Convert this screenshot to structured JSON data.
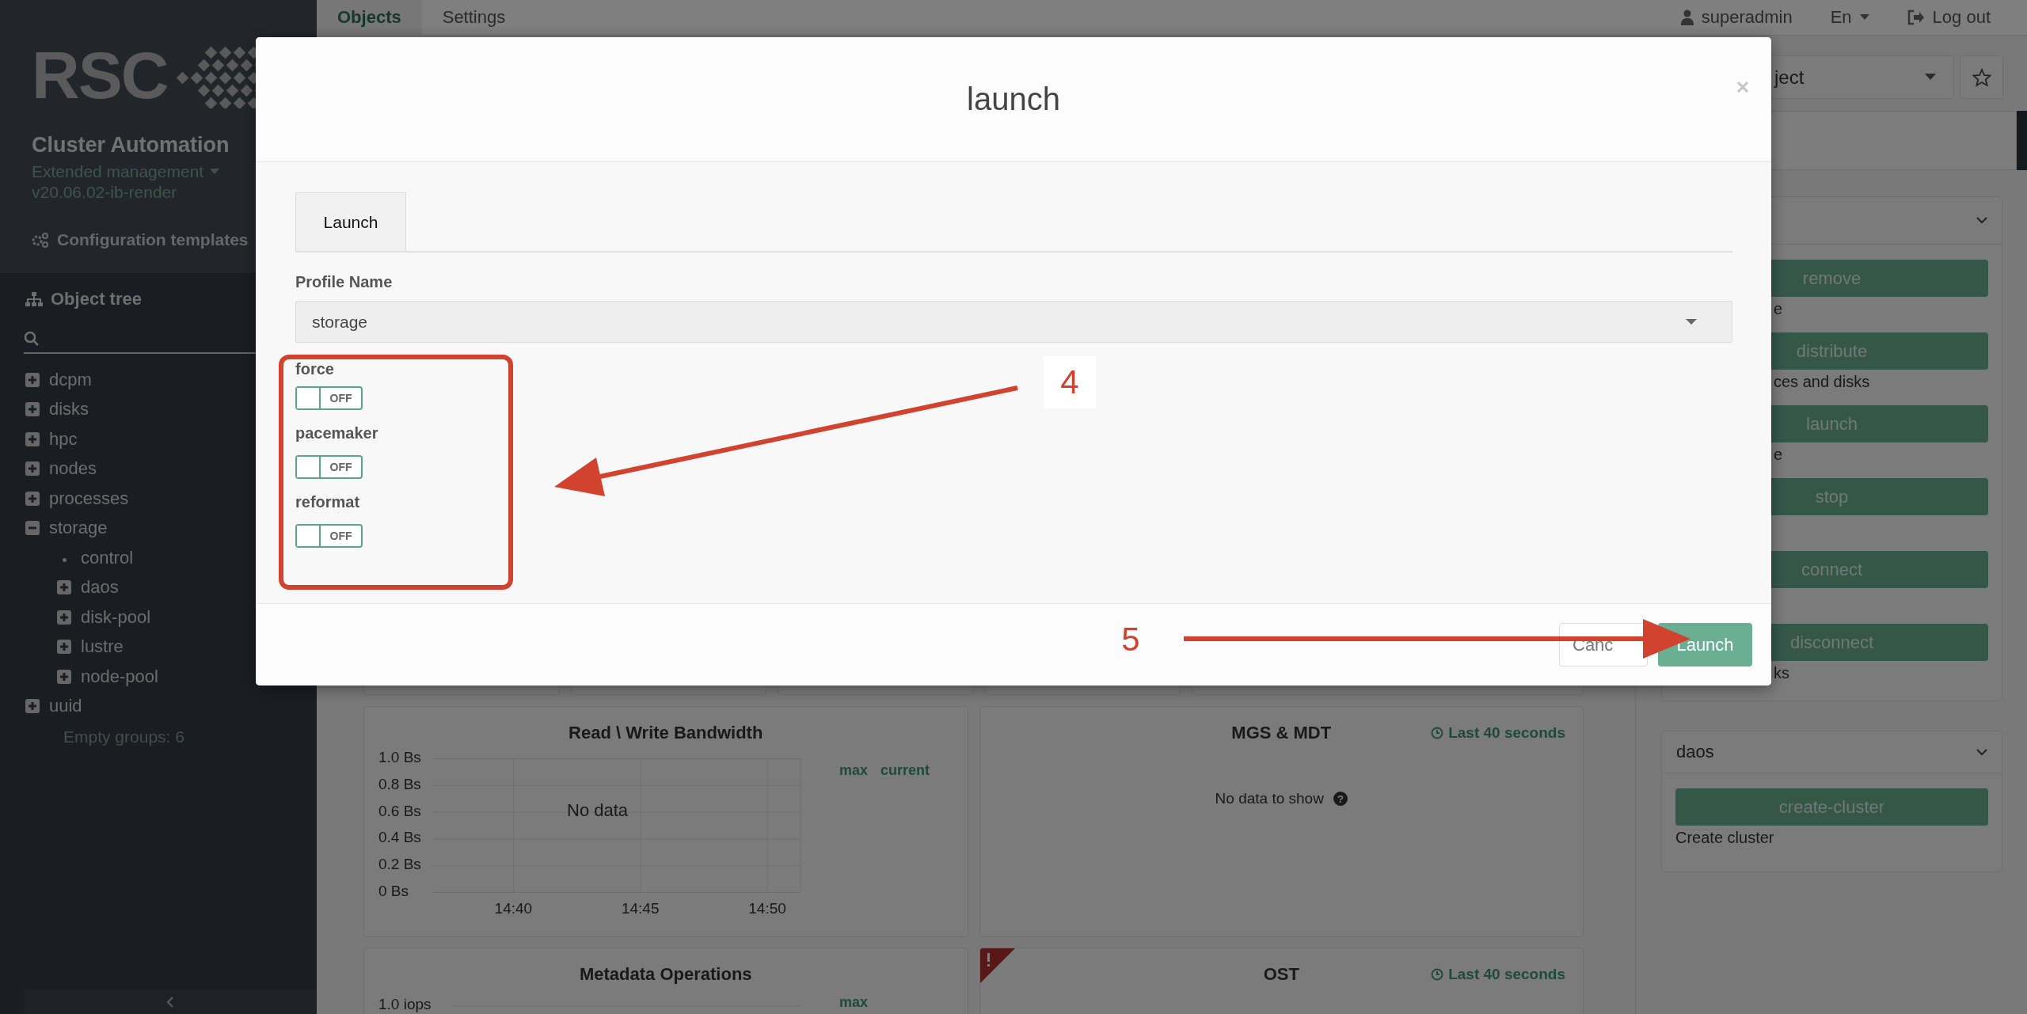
{
  "sidebar": {
    "logo": "RSC",
    "app_title": "Cluster Automation",
    "edition": "Extended management",
    "version": "v20.06.02-ib-render",
    "config_link": "Configuration templates",
    "tree_title": "Object tree",
    "tree": [
      {
        "label": "dcpm",
        "expanded": false
      },
      {
        "label": "disks",
        "expanded": false
      },
      {
        "label": "hpc",
        "expanded": false
      },
      {
        "label": "nodes",
        "expanded": false
      },
      {
        "label": "processes",
        "expanded": false
      },
      {
        "label": "storage",
        "expanded": true,
        "children": [
          {
            "label": "control",
            "kind": "leaf"
          },
          {
            "label": "daos",
            "expanded": false
          },
          {
            "label": "disk-pool",
            "expanded": false
          },
          {
            "label": "lustre",
            "expanded": false
          },
          {
            "label": "node-pool",
            "expanded": false
          }
        ]
      },
      {
        "label": "uuid",
        "expanded": false
      }
    ],
    "empty_groups": "Empty groups: 6"
  },
  "topbar": {
    "tabs": [
      {
        "label": "Objects",
        "selected": true
      },
      {
        "label": "Settings",
        "selected": false
      }
    ],
    "user": "superadmin",
    "language": "En",
    "logout": "Log out"
  },
  "dashboard": {
    "charts": [
      {
        "kind": "bandwidth",
        "legend": [
          "max",
          "current"
        ],
        "overlay": "No data",
        "chart_data": {
          "type": "line",
          "title": "Read \\ Write Bandwidth",
          "ylim": [
            0,
            1
          ],
          "grid": true,
          "categories": [
            "14:40",
            "14:45",
            "14:50"
          ],
          "yticks": [
            {
              "value": 0,
              "label": "0 Bs"
            },
            {
              "value": 0.2,
              "label": "0.2 Bs"
            },
            {
              "value": 0.4,
              "label": "0.4 Bs"
            },
            {
              "value": 0.6,
              "label": "0.6 Bs"
            },
            {
              "value": 0.8,
              "label": "0.8 Bs"
            },
            {
              "value": 1,
              "label": "1.0 Bs"
            }
          ]
        }
      },
      {
        "kind": "message",
        "title": "MGS & MDT",
        "period": "Last 40 seconds",
        "message": "No data to show",
        "help_mark": "?",
        "alert": false
      },
      {
        "kind": "partial",
        "title": "Metadata Operations",
        "tick": "1.0 iops",
        "legend": [
          "max"
        ]
      },
      {
        "kind": "message",
        "title": "OST",
        "period": "Last 40 seconds",
        "alert": true
      }
    ]
  },
  "object_panel": {
    "select_value": "ject",
    "sections": [
      {
        "covered": true,
        "actions": [
          {
            "label": "remove",
            "description": "e"
          },
          {
            "label": "distribute",
            "description": "ces and disks"
          },
          {
            "label": "launch",
            "description": "e"
          },
          {
            "label": "stop"
          },
          {
            "label": "connect"
          },
          {
            "label": "disconnect",
            "description": "ks"
          }
        ]
      },
      {
        "covered": false,
        "title": "daos",
        "actions": [
          {
            "label": "create-cluster",
            "description": "Create cluster"
          }
        ]
      }
    ]
  },
  "modal": {
    "title": "launch",
    "tabs": [
      {
        "label": "Launch",
        "selected": true
      }
    ],
    "profile": {
      "label": "Profile Name",
      "value": "storage"
    },
    "switches": [
      {
        "label": "force",
        "on": false,
        "text": "OFF"
      },
      {
        "label": "pacemaker",
        "on": false,
        "text": "OFF"
      },
      {
        "label": "reformat",
        "on": false,
        "text": "OFF"
      }
    ],
    "buttons": [
      {
        "label": "Canc",
        "kind": "secondary"
      },
      {
        "label": "Launch",
        "kind": "primary"
      }
    ]
  },
  "annotations": [
    {
      "label": "4"
    },
    {
      "label": "5"
    }
  ]
}
